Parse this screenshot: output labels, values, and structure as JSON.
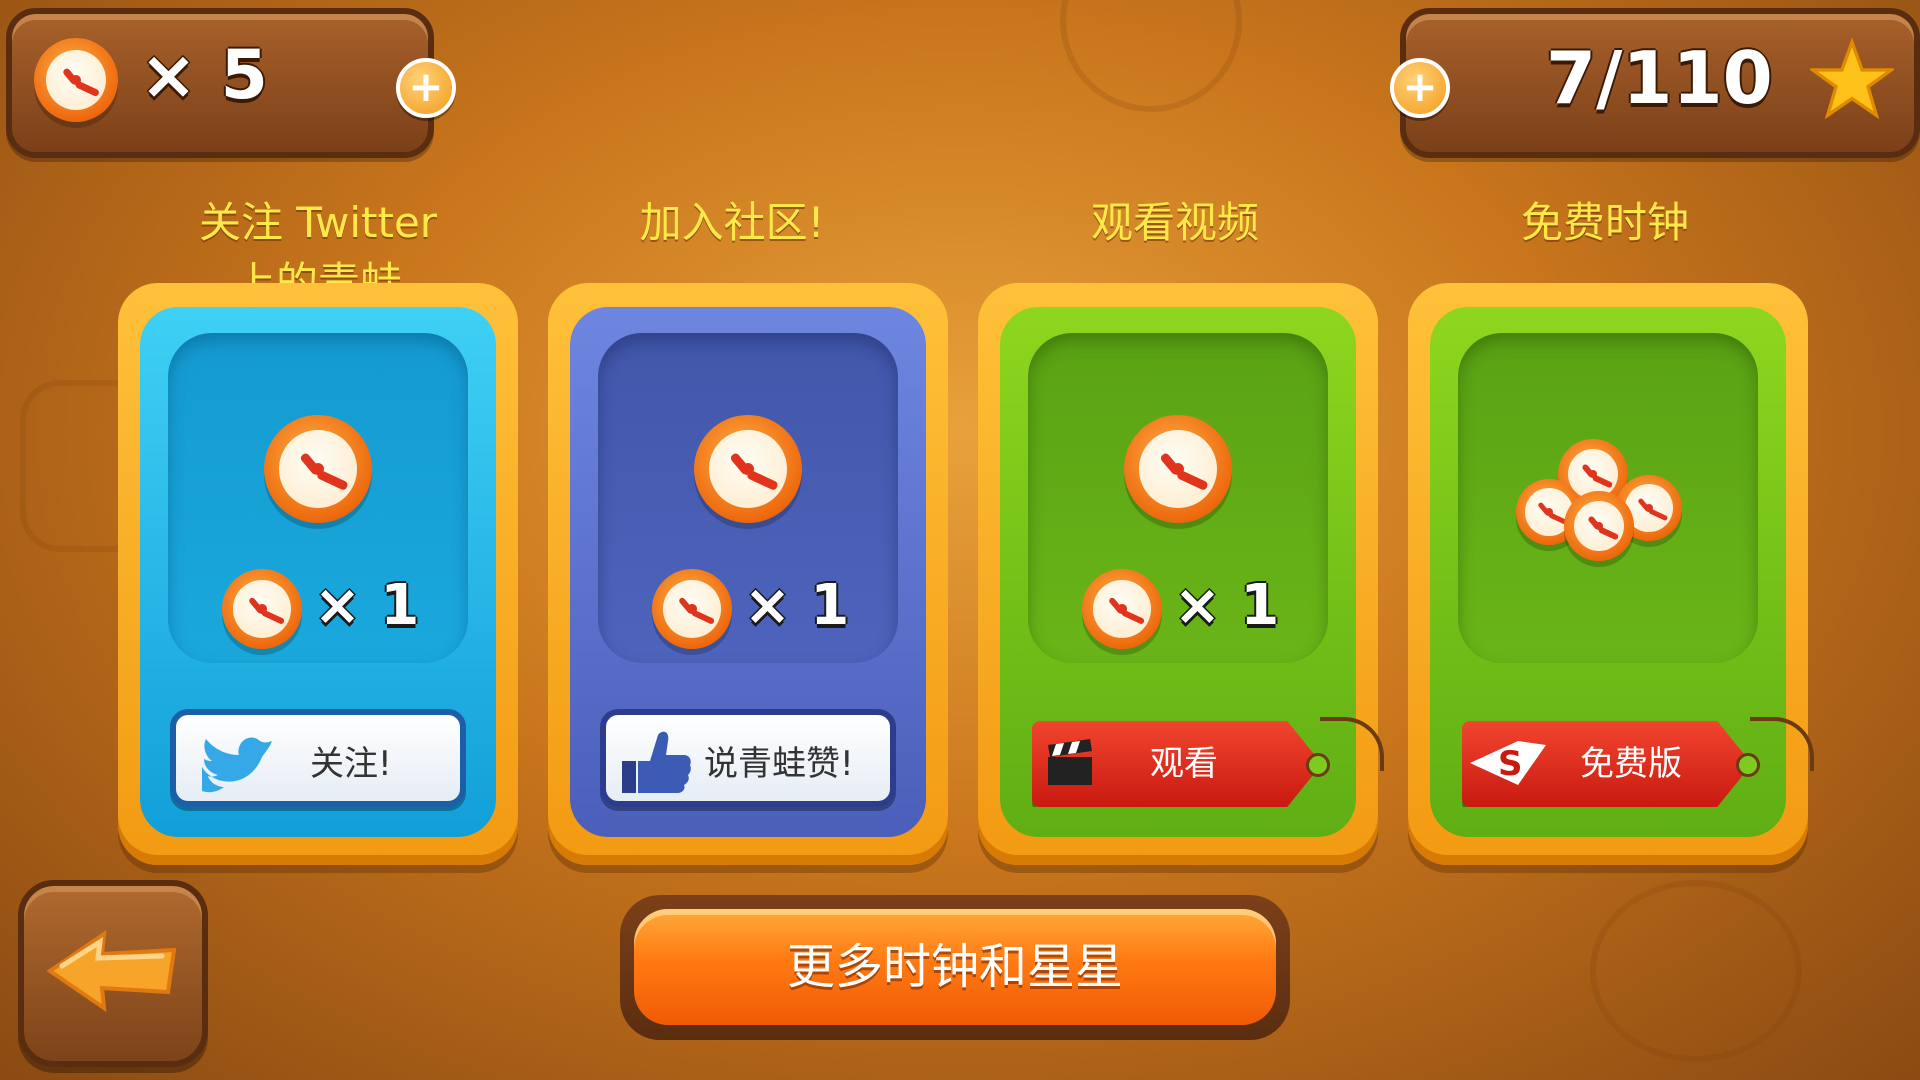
{
  "top_bar": {
    "clock_count": "× 5",
    "star_progress": "7/110"
  },
  "cards": [
    {
      "title": "关注 Twitter\n上的青蛙",
      "reward": "× 1",
      "button_label": "关注!",
      "button_icon": "twitter-bird-icon"
    },
    {
      "title": "加入社区!",
      "reward": "× 1",
      "button_label": "说青蛙赞!",
      "button_icon": "thumbs-up-icon"
    },
    {
      "title": "观看视频",
      "reward": "× 1",
      "button_label": "观看",
      "button_icon": "clapperboard-icon"
    },
    {
      "title": "免费时钟",
      "button_label": "免费版",
      "button_icon": "s-logo-icon"
    }
  ],
  "bottom": {
    "more_button_label": "更多时钟和星星"
  },
  "colors": {
    "background": "#c9761c",
    "card_blue": "#1aa8dc",
    "card_purple": "#4e64bc",
    "card_green": "#6ab518",
    "accent_orange": "#ff7a12",
    "title_yellow": "#ffe84a"
  }
}
